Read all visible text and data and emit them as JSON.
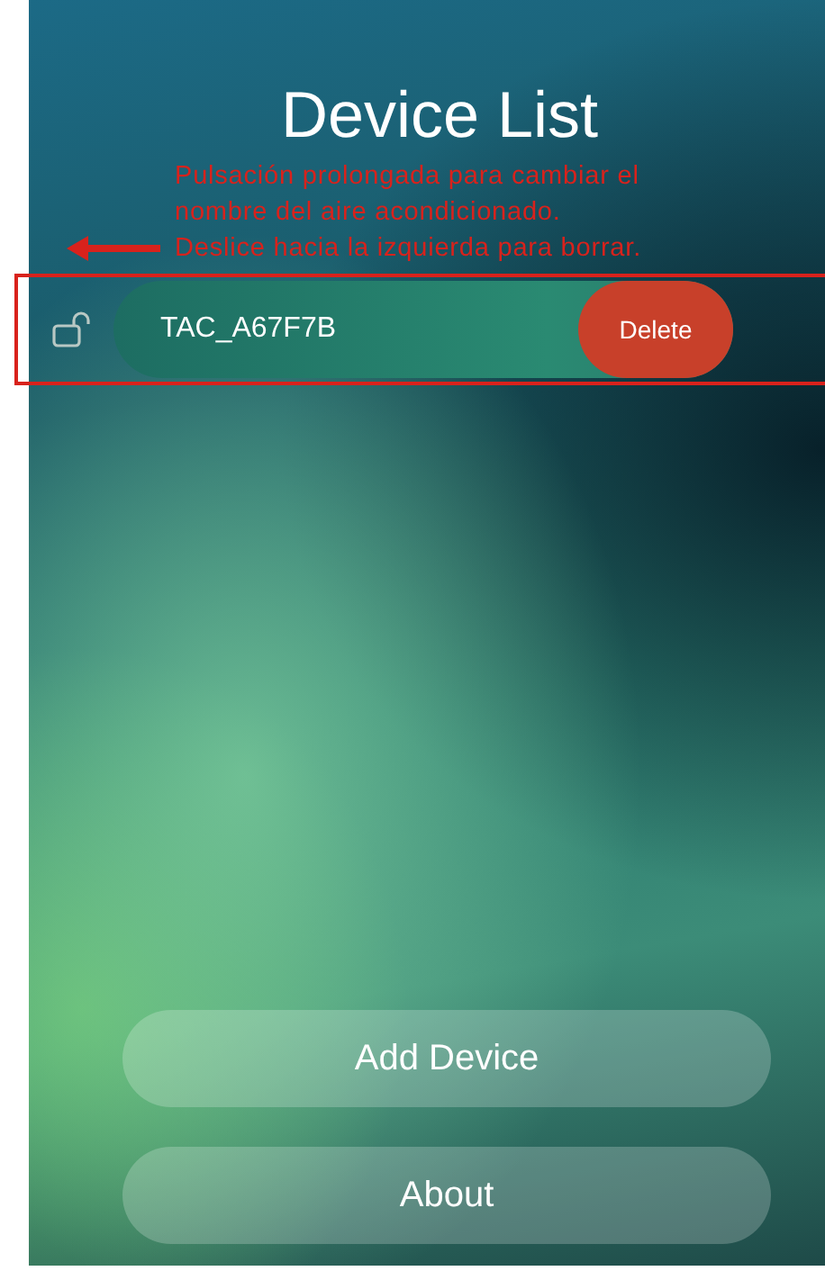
{
  "title": "Device List",
  "annotation": {
    "lines": [
      "Pulsación prolongada para cambiar el",
      "nombre del aire acondicionado."
    ],
    "swipe_hint": "Deslice hacia la izquierda para borrar."
  },
  "devices": [
    {
      "name": "TAC_A67F7B",
      "locked": false,
      "action": "Delete"
    }
  ],
  "buttons": [
    "Add Device",
    "About"
  ]
}
